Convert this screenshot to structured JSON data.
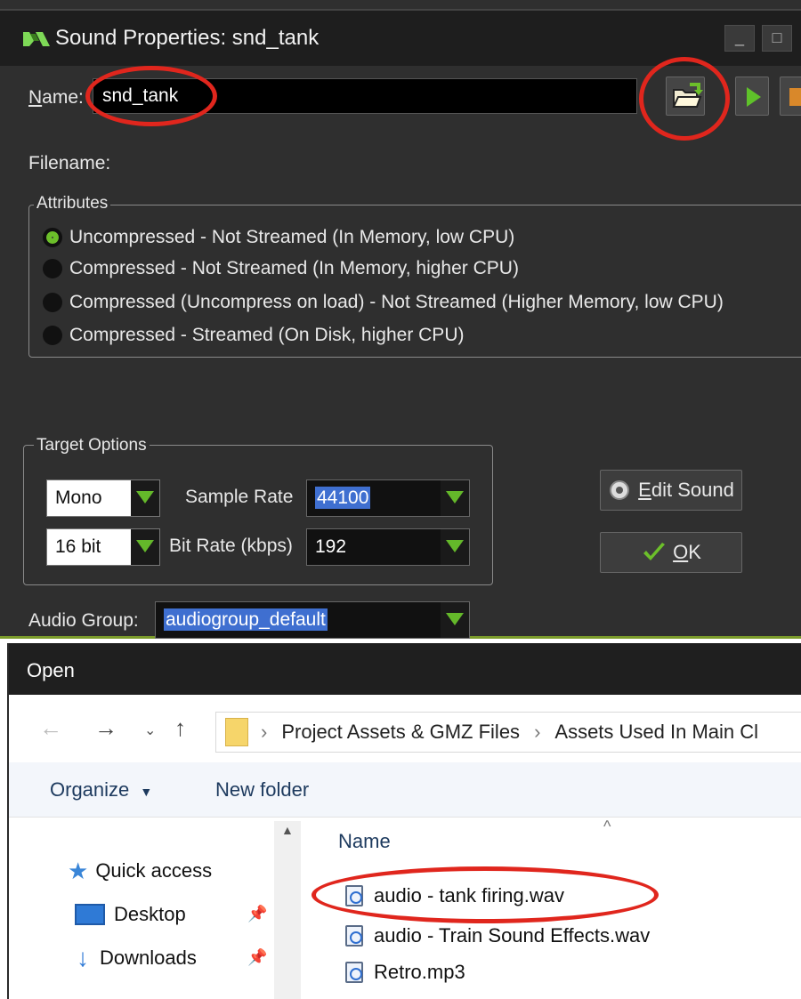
{
  "sound_props": {
    "title": "Sound Properties: snd_tank",
    "name_label": "Name:",
    "name_value": "snd_tank",
    "filename_label": "Filename:",
    "attributes": {
      "legend": "Attributes",
      "options": [
        {
          "label": "Uncompressed - Not Streamed (In Memory, low CPU)",
          "selected": true
        },
        {
          "label": "Compressed - Not Streamed (In Memory, higher CPU)",
          "selected": false
        },
        {
          "label": "Compressed (Uncompress on load) - Not Streamed (Higher Memory, low CPU)",
          "selected": false
        },
        {
          "label": "Compressed - Streamed (On Disk, higher CPU)",
          "selected": false
        }
      ]
    },
    "target_options": {
      "legend": "Target Options",
      "channels": "Mono",
      "bit_depth": "16 bit",
      "sample_rate_label": "Sample Rate",
      "sample_rate": "44100",
      "bit_rate_label": "Bit Rate (kbps)",
      "bit_rate": "192"
    },
    "edit_sound_label": "Edit Sound",
    "ok_label": "OK",
    "audio_group_label": "Audio Group:",
    "audio_group": "audiogroup_default",
    "colors": {
      "accent_green": "#64b82a",
      "highlight_circle": "#e0261d",
      "selection_blue": "#3f6fd0"
    }
  },
  "open_dialog": {
    "title": "Open",
    "breadcrumb": [
      "Project Assets & GMZ Files",
      "Assets Used In Main Cl"
    ],
    "organize_label": "Organize",
    "new_folder_label": "New folder",
    "nav_items": [
      {
        "label": "Quick access",
        "icon": "star-icon"
      },
      {
        "label": "Desktop",
        "icon": "desktop-icon"
      },
      {
        "label": "Downloads",
        "icon": "download-icon"
      }
    ],
    "column_name": "Name",
    "files": [
      "audio - tank firing.wav",
      "audio - Train Sound Effects.wav",
      "Retro.mp3"
    ]
  }
}
